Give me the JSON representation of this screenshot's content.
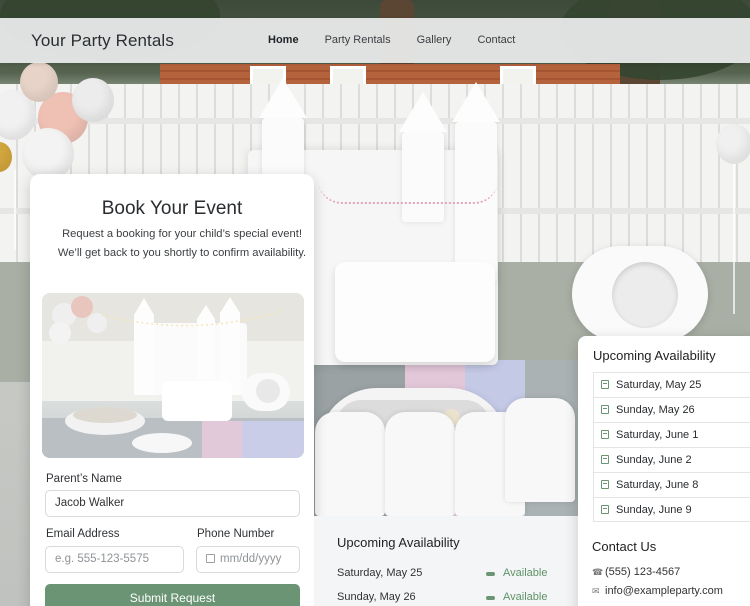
{
  "header": {
    "brand": "Your Party Rentals",
    "nav": [
      "Home",
      "Party Rentals",
      "Gallery",
      "Contact"
    ],
    "active": "Home"
  },
  "booking": {
    "title": "Book Your Event",
    "subtitle": "Request a booking for your child’s special event! We’ll get back to you shortly to confirm availability.",
    "parent_label": "Parent’s Name",
    "parent_value": "Jacob Walker",
    "email_label": "Email Address",
    "email_placeholder": "e.g. 555-123-5575",
    "phone_label": "Phone Number",
    "phone_placeholder": "mm/dd/yyyy",
    "submit_label": "Submit Request"
  },
  "upcoming": {
    "title": "Upcoming Availability",
    "dates": [
      "Saturday, May 25",
      "Sunday, May 26",
      "Saturday, June 1",
      "Sunday, June 2",
      "Saturday, June 8",
      "Sunday, June 9"
    ]
  },
  "contact": {
    "title": "Contact Us",
    "phone": "(555) 123-4567",
    "email": "info@exampleparty.com"
  },
  "bottom_availability": {
    "title": "Upcoming Availability",
    "rows": [
      {
        "date": "Saturday, May 25",
        "status": "Available"
      },
      {
        "date": "Sunday, May 26",
        "status": "Available"
      }
    ]
  },
  "colors": {
    "accent": "#6a9473",
    "header_bg": "#ecedee"
  }
}
